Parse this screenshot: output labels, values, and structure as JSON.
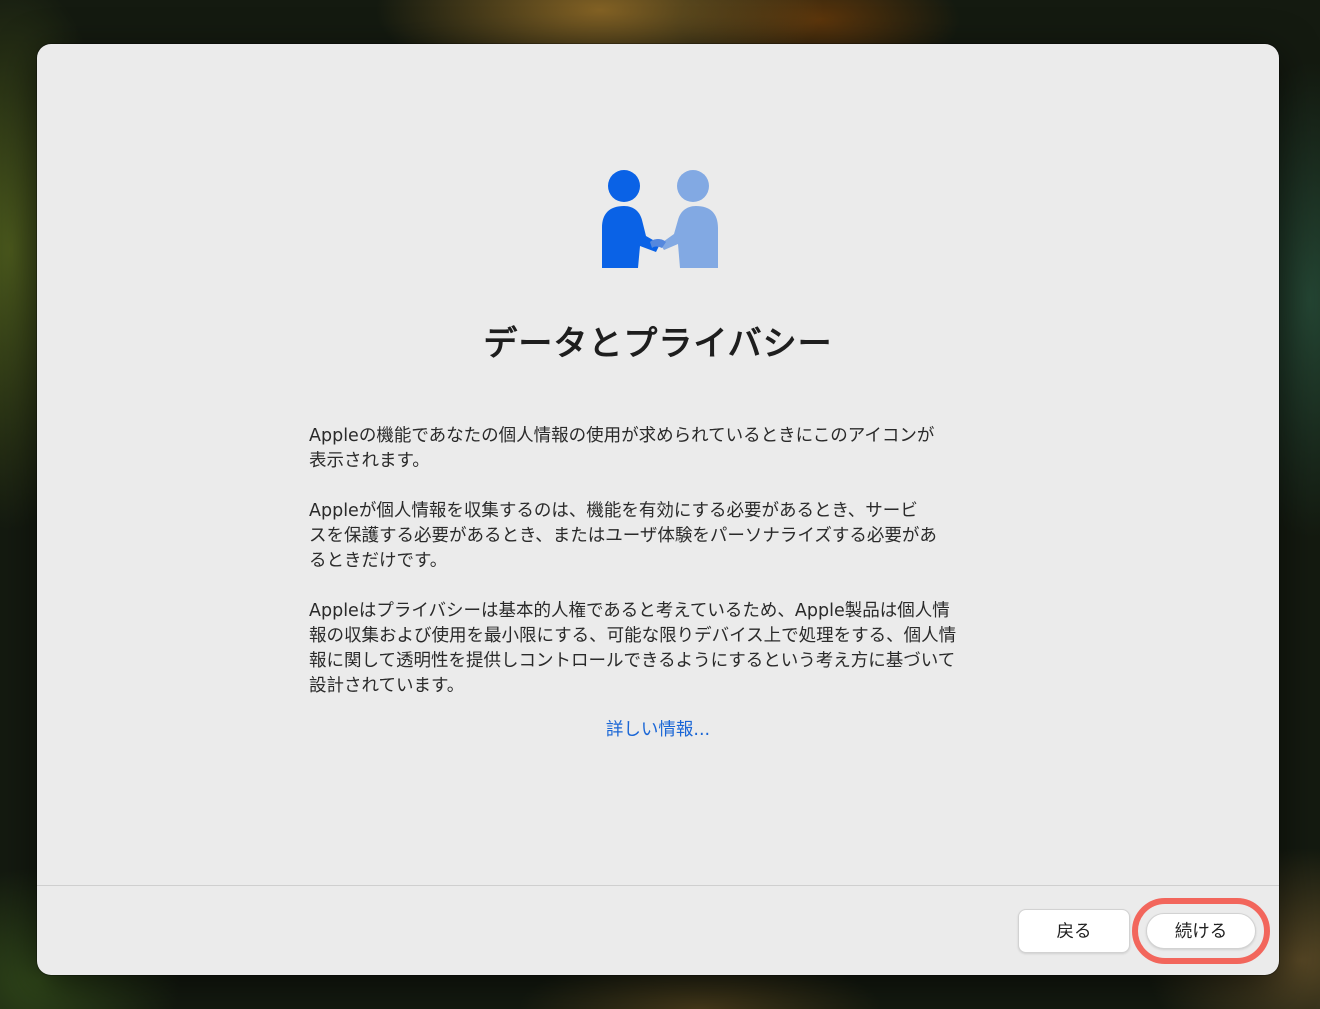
{
  "window": {
    "title": "データとプライバシー",
    "icon": "people-handshake-icon",
    "accent_dark": "#0a62e6",
    "accent_light": "#82a9e3"
  },
  "body": {
    "paragraph1": "Appleの機能であなたの個人情報の使用が求められているときにこのアイコンが\n表示されます。",
    "paragraph2": "Appleが個人情報を収集するのは、機能を有効にする必要があるとき、サービ\nスを保護する必要があるとき、またはユーザ体験をパーソナライズする必要があ\nるときだけです。",
    "paragraph3": "Appleはプライバシーは基本的人権であると考えているため、Apple製品は個人情\n報の収集および使用を最小限にする、可能な限りデバイス上で処理をする、個人情\n報に関して透明性を提供しコントロールできるようにするという考え方に基づいて\n設計されています。"
  },
  "link": {
    "label": "詳しい情報..."
  },
  "footer": {
    "back_label": "戻る",
    "continue_label": "続ける",
    "highlight_color": "#f2665c"
  }
}
